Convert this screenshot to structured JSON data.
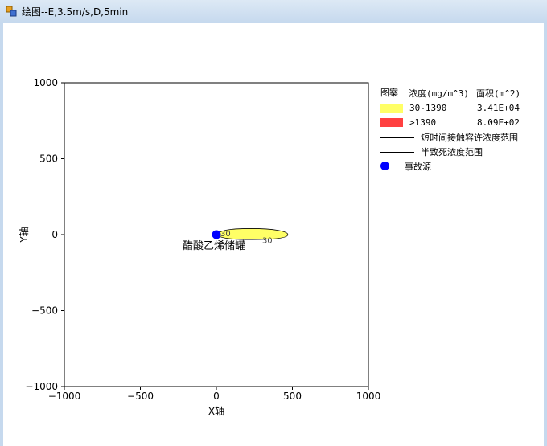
{
  "window": {
    "title": "绘图--E,3.5m/s,D,5min"
  },
  "legend": {
    "header": {
      "pattern": "图案",
      "concentration": "浓度(mg/m^3)",
      "area": "面积(m^2)"
    },
    "items": [
      {
        "range": "30-1390",
        "area": "3.41E+04",
        "color": "#ffff66"
      },
      {
        "range": ">1390",
        "area": "8.09E+02",
        "color": "#ff4040"
      }
    ],
    "lines": [
      "短时间接触容许浓度范围",
      "半致死浓度范围"
    ],
    "source_label": "事故源"
  },
  "chart_data": {
    "type": "contour",
    "xlabel": "X轴",
    "ylabel": "Y轴",
    "xlim": [
      -1000,
      1000
    ],
    "ylim": [
      -1000,
      1000
    ],
    "xticks": [
      "−1000",
      "−500",
      "0",
      "500",
      "1000"
    ],
    "yticks": [
      "1000",
      "500",
      "0",
      "−500",
      "−1000"
    ],
    "grid": false,
    "legend_position": "right",
    "source": {
      "x": 0,
      "y": 0,
      "label": "醋酸乙烯储罐",
      "color": "#0000ff"
    },
    "plume": {
      "x_start": 0,
      "x_end": 470,
      "half_width_y": 40,
      "contour_value": "30",
      "color": "#ffff66"
    },
    "contour_labels": [
      {
        "text": "30",
        "x": 60,
        "y": 10
      },
      {
        "text": "30",
        "x": 335,
        "y": -35
      }
    ]
  }
}
